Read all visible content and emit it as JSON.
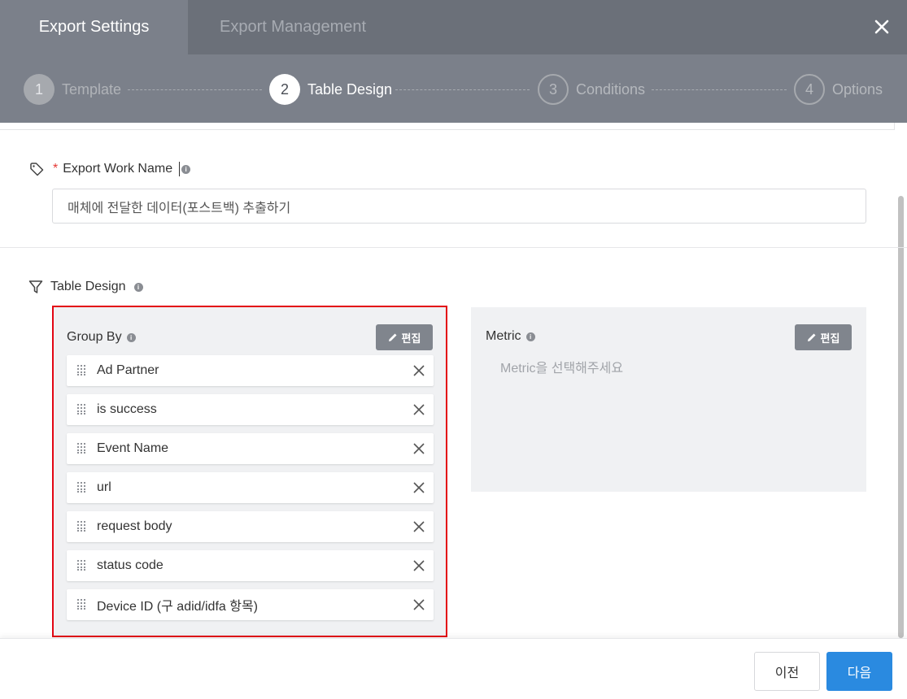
{
  "tabs": [
    {
      "label": "Export Settings",
      "active": true
    },
    {
      "label": "Export Management",
      "active": false
    }
  ],
  "steps": [
    {
      "number": "1",
      "label": "Template",
      "state": "done"
    },
    {
      "number": "2",
      "label": "Table Design",
      "state": "current"
    },
    {
      "number": "3",
      "label": "Conditions",
      "state": "todo"
    },
    {
      "number": "4",
      "label": "Options",
      "state": "todo"
    }
  ],
  "work_name": {
    "required_mark": "*",
    "label": "Export Work Name",
    "value": "매체에 전달한 데이터(포스트백) 추출하기"
  },
  "table_design": {
    "label": "Table Design",
    "group_by": {
      "title": "Group By",
      "edit_label": "편집",
      "items": [
        "Ad Partner",
        "is success",
        "Event Name",
        "url",
        "request body",
        "status code",
        "Device ID (구 adid/idfa 항목)"
      ]
    },
    "metric": {
      "title": "Metric",
      "edit_label": "편집",
      "placeholder": "Metric을 선택해주세요"
    }
  },
  "footer": {
    "prev_label": "이전",
    "next_label": "다음"
  },
  "colors": {
    "header": "#6b7079",
    "stepper": "#7b808a",
    "highlight": "#e30613",
    "primary": "#2a8ae0"
  },
  "icons": {
    "close": "close-icon",
    "tag": "tag-icon",
    "filter": "filter-icon",
    "info": "info-icon",
    "edit": "pencil-icon",
    "drag": "drag-handle-icon",
    "remove": "remove-icon"
  }
}
